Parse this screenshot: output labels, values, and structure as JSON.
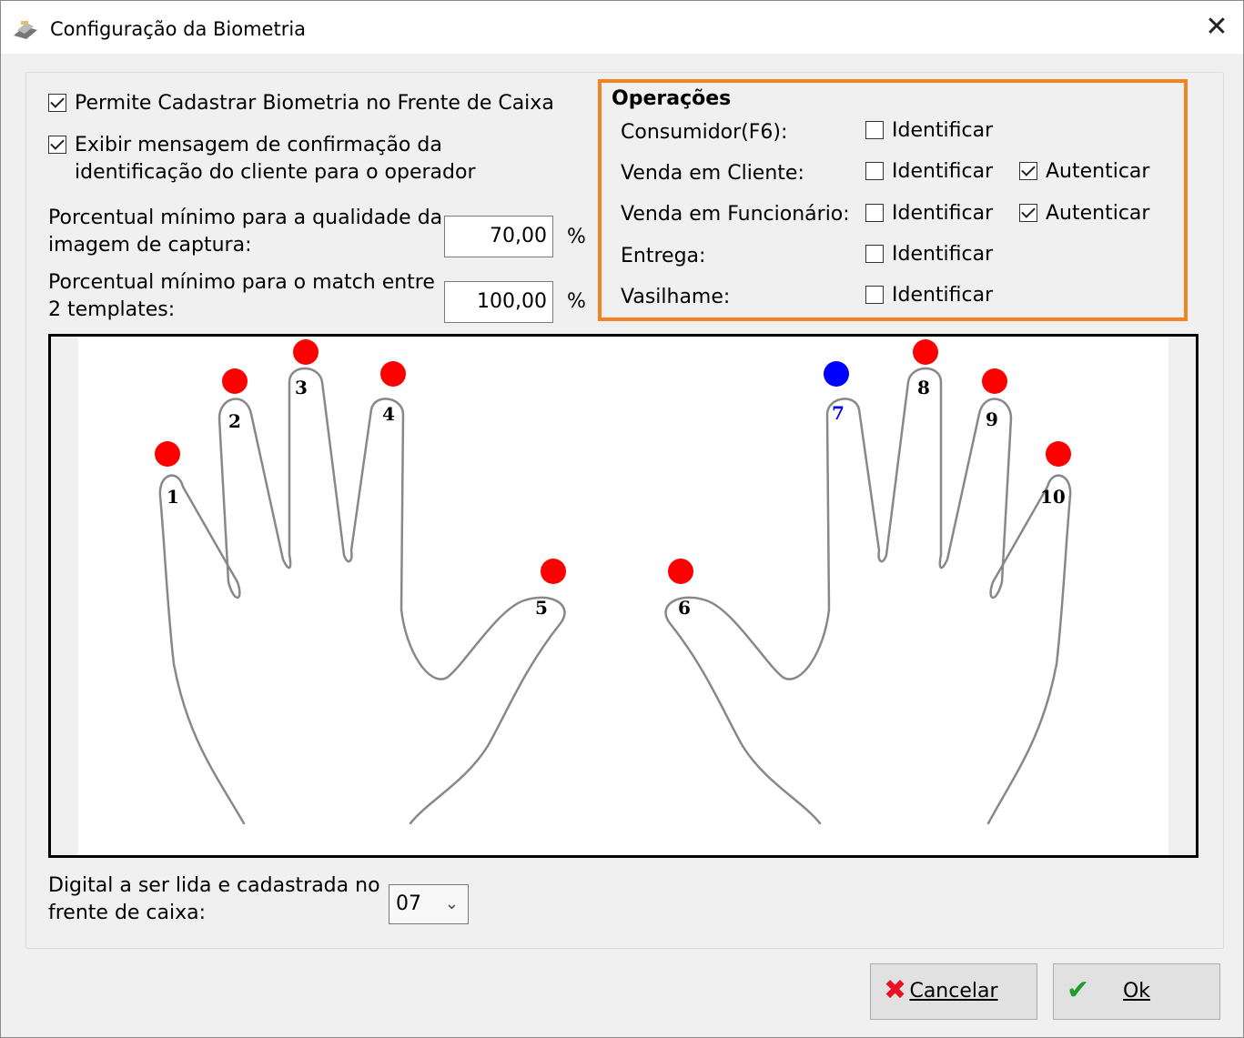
{
  "window": {
    "title": "Configuração da Biometria",
    "close_glyph": "✕"
  },
  "options": {
    "permite_cadastrar": {
      "label": "Permite Cadastrar Biometria no Frente de Caixa",
      "checked": true
    },
    "exibir_mensagem": {
      "line1": "Exibir mensagem de confirmação da",
      "line2": "identificação do cliente para o operador",
      "checked": true
    }
  },
  "qualidade": {
    "line1": "Porcentual mínimo para a qualidade da",
    "line2": "imagem de captura:",
    "value": "70,00",
    "unit": "%"
  },
  "match": {
    "line1": "Porcentual mínimo para o match entre",
    "line2": "2 templates:",
    "value": "100,00",
    "unit": "%"
  },
  "operacoes": {
    "title": "Operações",
    "rows": [
      {
        "label": "Consumidor(F6):",
        "identificar": {
          "label": "Identificar",
          "checked": false
        }
      },
      {
        "label": "Venda em Cliente:",
        "identificar": {
          "label": "Identificar",
          "checked": false
        },
        "autenticar": {
          "label": "Autenticar",
          "checked": true
        }
      },
      {
        "label": "Venda em Funcionário:",
        "identificar": {
          "label": "Identificar",
          "checked": false
        },
        "autenticar": {
          "label": "Autenticar",
          "checked": true
        }
      },
      {
        "label": "Entrega:",
        "identificar": {
          "label": "Identificar",
          "checked": false
        }
      },
      {
        "label": "Vasilhame:",
        "identificar": {
          "label": "Identificar",
          "checked": false
        }
      }
    ]
  },
  "fingers": [
    {
      "num": "1",
      "selected": false
    },
    {
      "num": "2",
      "selected": false
    },
    {
      "num": "3",
      "selected": false
    },
    {
      "num": "4",
      "selected": false
    },
    {
      "num": "5",
      "selected": false
    },
    {
      "num": "6",
      "selected": false
    },
    {
      "num": "7",
      "selected": true
    },
    {
      "num": "8",
      "selected": false
    },
    {
      "num": "9",
      "selected": false
    },
    {
      "num": "10",
      "selected": false
    }
  ],
  "colors": {
    "dot_default": "#ff0000",
    "dot_selected": "#0000ff",
    "accent_frame": "#f58220",
    "cancel_icon": "#e81123",
    "ok_icon": "#1f9e2e"
  },
  "digital": {
    "line1": "Digital a ser lida e cadastrada no",
    "line2": "frente de caixa:",
    "selected": "07"
  },
  "buttons": {
    "cancel": {
      "label": "Cancelar",
      "icon": "close-x-icon"
    },
    "ok": {
      "label": "Ok",
      "icon": "checkmark-icon"
    }
  }
}
